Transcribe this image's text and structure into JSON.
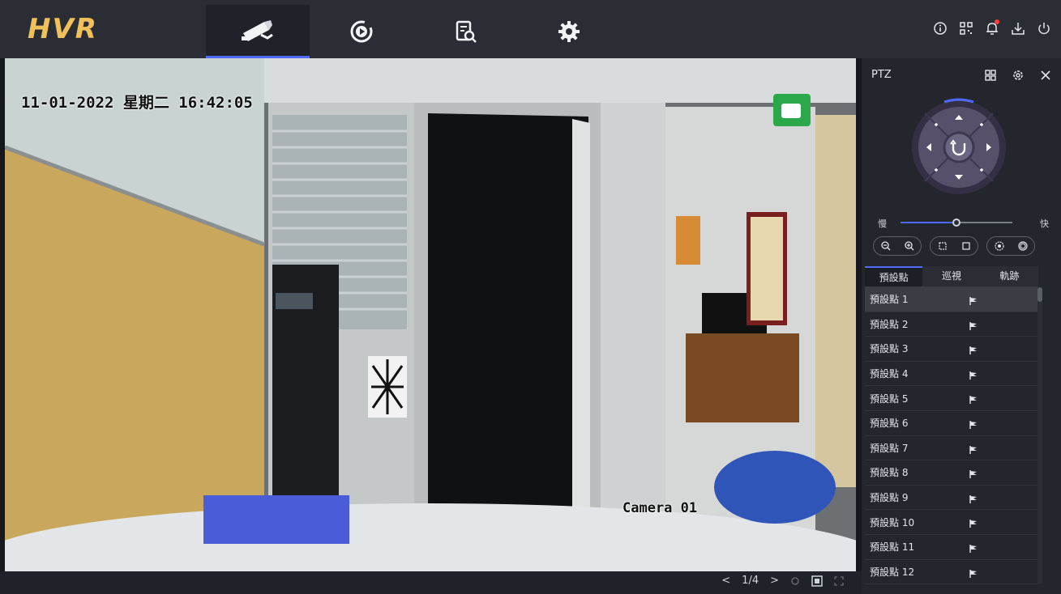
{
  "app": {
    "logo": "HVR"
  },
  "nav": {
    "tabs": [
      {
        "name": "live-view",
        "icon": "camera-icon"
      },
      {
        "name": "playback",
        "icon": "playback-icon"
      },
      {
        "name": "search",
        "icon": "file-search-icon"
      },
      {
        "name": "settings",
        "icon": "gear-icon"
      }
    ],
    "active": "live-view"
  },
  "top_icons": [
    "info-icon",
    "qr-code-icon",
    "bell-icon",
    "download-icon",
    "power-icon"
  ],
  "video": {
    "osd_datetime": "11-01-2022 星期二 16:42:05",
    "osd_camera": "Camera 01"
  },
  "pager": {
    "page": "1/4"
  },
  "ptz": {
    "title": "PTZ",
    "speed_slow": "慢",
    "speed_fast": "快",
    "speed_level": 0.5,
    "tabs": [
      "預設點",
      "巡視",
      "軌跡"
    ],
    "presets": [
      "預設點 1",
      "預設點 2",
      "預設點 3",
      "預設點 4",
      "預設點 5",
      "預設點 6",
      "預設點 7",
      "預設點 8",
      "預設點 9",
      "預設點 10",
      "預設點 11",
      "預設點 12"
    ]
  },
  "colors": {
    "accent": "#4f6bff",
    "logo": "#f0c15a",
    "alert": "#ff3b3b"
  }
}
